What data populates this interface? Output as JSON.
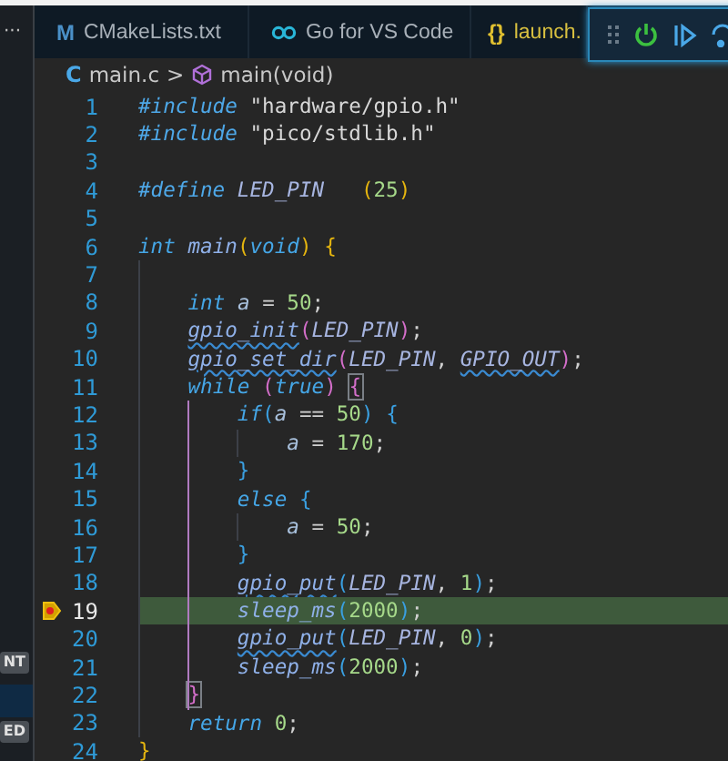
{
  "sidebar": {
    "more": "···",
    "labels": [
      "NT",
      "ED"
    ]
  },
  "tabs": [
    {
      "label": "CMakeLists.txt",
      "kind": "cmake",
      "icon_text": "M",
      "selected": false
    },
    {
      "label": "Go for VS Code",
      "kind": "go",
      "selected": false
    },
    {
      "label": "launch.",
      "kind": "json",
      "icon_text": "{}",
      "selected": false
    }
  ],
  "breadcrumb": {
    "file": "main.c",
    "file_icon_text": "C",
    "separator": ">",
    "symbol": "main(void)"
  },
  "lines": [
    {
      "number": "1",
      "tokens": [
        {
          "text": "#include",
          "kind": "pre"
        },
        {
          "text": " \"hardware/gpio.h\"",
          "kind": "str"
        }
      ]
    },
    {
      "number": "2",
      "tokens": [
        {
          "text": "#include",
          "kind": "pre"
        },
        {
          "text": " \"pico/stdlib.h\"",
          "kind": "str"
        }
      ]
    },
    {
      "number": "3"
    },
    {
      "number": "4",
      "tokens": [
        {
          "text": "#define",
          "kind": "pre"
        },
        {
          "text": " LED_PIN",
          "kind": "macro"
        },
        {
          "text": "   (",
          "kind": "b1"
        },
        {
          "text": "25",
          "kind": "num"
        },
        {
          "text": ")",
          "kind": "b1"
        }
      ]
    },
    {
      "number": "5"
    },
    {
      "number": "6",
      "tokens": [
        {
          "text": "int",
          "kind": "kw"
        },
        {
          "text": " main",
          "kind": "fn"
        },
        {
          "text": "(",
          "kind": "b1"
        },
        {
          "text": "void",
          "kind": "kw"
        },
        {
          "text": ")",
          "kind": "b1"
        },
        {
          "text": " {",
          "kind": "b1"
        }
      ]
    },
    {
      "number": "7"
    },
    {
      "number": "8",
      "tokens": [
        {
          "text": "    int",
          "kind": "kw"
        },
        {
          "text": " a",
          "kind": "var"
        },
        {
          "text": " = ",
          "kind": "op"
        },
        {
          "text": "50",
          "kind": "num"
        },
        {
          "text": ";",
          "kind": "op"
        }
      ]
    },
    {
      "number": "9",
      "tokens": [
        {
          "text": "    gpio_init",
          "kind": "fn",
          "squiggle": true
        },
        {
          "text": "(",
          "kind": "b2"
        },
        {
          "text": "LED_PIN",
          "kind": "macro"
        },
        {
          "text": ")",
          "kind": "b2"
        },
        {
          "text": ";",
          "kind": "op"
        }
      ]
    },
    {
      "number": "10",
      "tokens": [
        {
          "text": "    gpio_set_dir",
          "kind": "fn",
          "squiggle": true
        },
        {
          "text": "(",
          "kind": "b2"
        },
        {
          "text": "LED_PIN",
          "kind": "macro"
        },
        {
          "text": ", ",
          "kind": "op"
        },
        {
          "text": "GPIO_OUT",
          "kind": "macro",
          "squiggle": true
        },
        {
          "text": ")",
          "kind": "b2"
        },
        {
          "text": ";",
          "kind": "op"
        }
      ]
    },
    {
      "number": "11",
      "tokens": [
        {
          "text": "    while",
          "kind": "kw"
        },
        {
          "text": " (",
          "kind": "b2"
        },
        {
          "text": "true",
          "kind": "kw"
        },
        {
          "text": ")",
          "kind": "b2"
        },
        {
          "text": " {",
          "kind": "b2",
          "matched": true
        }
      ]
    },
    {
      "number": "12",
      "active_guide": true,
      "tokens": [
        {
          "text": "        if",
          "kind": "kw"
        },
        {
          "text": "(",
          "kind": "b3"
        },
        {
          "text": "a",
          "kind": "var"
        },
        {
          "text": " == ",
          "kind": "op"
        },
        {
          "text": "50",
          "kind": "num"
        },
        {
          "text": ")",
          "kind": "b3"
        },
        {
          "text": " {",
          "kind": "b3"
        }
      ]
    },
    {
      "number": "13",
      "active_guide": true,
      "tokens": [
        {
          "text": "            a",
          "kind": "var"
        },
        {
          "text": " = ",
          "kind": "op"
        },
        {
          "text": "170",
          "kind": "num"
        },
        {
          "text": ";",
          "kind": "op"
        }
      ]
    },
    {
      "number": "14",
      "active_guide": true,
      "tokens": [
        {
          "text": "        }",
          "kind": "b3"
        }
      ]
    },
    {
      "number": "15",
      "active_guide": true,
      "tokens": [
        {
          "text": "        else",
          "kind": "kw"
        },
        {
          "text": " {",
          "kind": "b3"
        }
      ]
    },
    {
      "number": "16",
      "active_guide": true,
      "tokens": [
        {
          "text": "            a",
          "kind": "var"
        },
        {
          "text": " = ",
          "kind": "op"
        },
        {
          "text": "50",
          "kind": "num"
        },
        {
          "text": ";",
          "kind": "op"
        }
      ]
    },
    {
      "number": "17",
      "active_guide": true,
      "tokens": [
        {
          "text": "        }",
          "kind": "b3"
        }
      ]
    },
    {
      "number": "18",
      "active_guide": true,
      "tokens": [
        {
          "text": "        gpio_put",
          "kind": "fn",
          "squiggle": true
        },
        {
          "text": "(",
          "kind": "b3"
        },
        {
          "text": "LED_PIN",
          "kind": "macro"
        },
        {
          "text": ", ",
          "kind": "op"
        },
        {
          "text": "1",
          "kind": "num"
        },
        {
          "text": ")",
          "kind": "b3"
        },
        {
          "text": ";",
          "kind": "op"
        }
      ]
    },
    {
      "number": "19",
      "active_guide": true,
      "current": true,
      "tokens": [
        {
          "text": "        sleep_ms",
          "kind": "fn"
        },
        {
          "text": "(",
          "kind": "b3"
        },
        {
          "text": "2000",
          "kind": "num"
        },
        {
          "text": ")",
          "kind": "b3"
        },
        {
          "text": ";",
          "kind": "op"
        }
      ]
    },
    {
      "number": "20",
      "active_guide": true,
      "tokens": [
        {
          "text": "        gpio_put",
          "kind": "fn",
          "squiggle": true
        },
        {
          "text": "(",
          "kind": "b3"
        },
        {
          "text": "LED_PIN",
          "kind": "macro"
        },
        {
          "text": ", ",
          "kind": "op"
        },
        {
          "text": "0",
          "kind": "num"
        },
        {
          "text": ")",
          "kind": "b3"
        },
        {
          "text": ";",
          "kind": "op"
        }
      ]
    },
    {
      "number": "21",
      "active_guide": true,
      "tokens": [
        {
          "text": "        sleep_ms",
          "kind": "fn"
        },
        {
          "text": "(",
          "kind": "b3"
        },
        {
          "text": "2000",
          "kind": "num"
        },
        {
          "text": ")",
          "kind": "b3"
        },
        {
          "text": ";",
          "kind": "op"
        }
      ]
    },
    {
      "number": "22",
      "active_guide": true,
      "tokens": [
        {
          "text": "    }",
          "kind": "b2",
          "matched": true
        }
      ]
    },
    {
      "number": "23",
      "tokens": [
        {
          "text": "    return",
          "kind": "kw"
        },
        {
          "text": " 0",
          "kind": "num"
        },
        {
          "text": ";",
          "kind": "op"
        }
      ]
    },
    {
      "number": "24",
      "tokens": [
        {
          "text": "}",
          "kind": "b1"
        }
      ]
    }
  ]
}
